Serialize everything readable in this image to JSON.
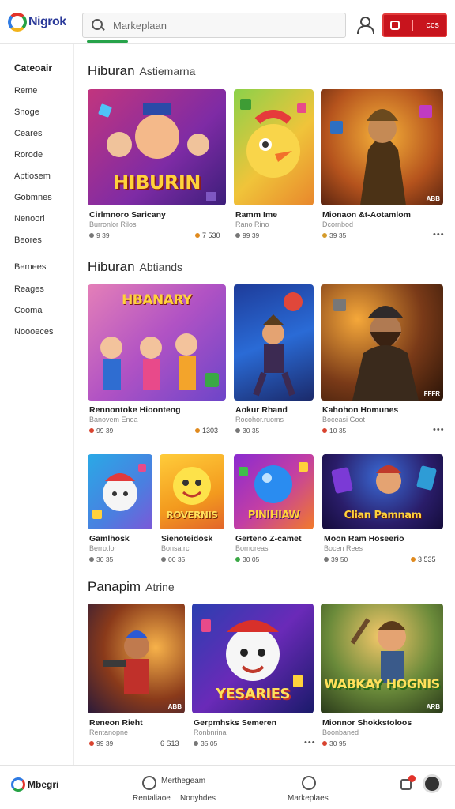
{
  "header": {
    "logo_text": "Nigrok",
    "search_placeholder": "Markeplaan",
    "cta_label": "ccs"
  },
  "sidebar": {
    "title": "Cateoair",
    "items": [
      "Reme",
      "Snoge",
      "Ceares",
      "Rorode",
      "Aptiosem",
      "Gobmnes",
      "Nenoorl",
      "Beores",
      "Bemees",
      "Reages",
      "Cooma",
      "Noooeces"
    ]
  },
  "sections": [
    {
      "title": "Hiburan",
      "subtitle": "Astiemarna"
    },
    {
      "title": "Hiburan",
      "subtitle": "Abtiands"
    },
    {
      "title": "Panapim",
      "subtitle": "Atrine"
    }
  ],
  "cards": [
    {
      "title": "Cirlmnoro Saricany",
      "sub": "Burronlor Rilos",
      "meta": "9 39",
      "price": "7 530",
      "thumb_text": "HIBURIN"
    },
    {
      "title": "Ramm Ime",
      "sub": "Rano Rino",
      "meta": "99 39",
      "price": "",
      "thumb_text": ""
    },
    {
      "title": "Mionaon &t-Aotamlom",
      "sub": "Dcornbod",
      "meta": "39 35",
      "price": "",
      "thumb_text": "",
      "badge": "ABB"
    },
    {
      "title": "Rennontoke Hioonteng",
      "sub": "Banovem Enoa",
      "meta": "99 39",
      "price": "1303",
      "thumb_text": "HBANARY"
    },
    {
      "title": "Aokur Rhand",
      "sub": "Rocohor.ruoms",
      "meta": "30 35",
      "price": "",
      "thumb_text": ""
    },
    {
      "title": "Kahohon Homunes",
      "sub": "Boceasi Goot",
      "meta": "10 35",
      "price": "",
      "thumb_text": "",
      "badge": "FFFR"
    },
    {
      "title": "Gamlhosk",
      "sub": "Berro.lor",
      "meta": "30 35",
      "price": "",
      "thumb_text": ""
    },
    {
      "title": "Sienoteidosk",
      "sub": "Bonsa.rcl",
      "meta": "00 35",
      "price": "",
      "thumb_text": "ROVERNIS"
    },
    {
      "title": "Gerteno Z-camet",
      "sub": "Bornoreas",
      "meta": "30 05",
      "price": "",
      "thumb_text": "PINIHIAW"
    },
    {
      "title": "Moon Ram Hoseerio",
      "sub": "Bocen Rees",
      "meta": "39 50",
      "price": "3 535",
      "thumb_text": "Clian Pamnam"
    },
    {
      "title": "Reneon Rieht",
      "sub": "Rentanopne",
      "meta": "99 39",
      "price": "6 S13",
      "thumb_text": "",
      "badge": "ABB"
    },
    {
      "title": "Gerpmhsks Semeren",
      "sub": "Ronbnrinal",
      "meta": "35 05",
      "price": "",
      "thumb_text": "YESARIES"
    },
    {
      "title": "Mionnor Shokkstoloos",
      "sub": "Boonbaned",
      "meta": "30 95",
      "price": "",
      "thumb_text": "WABKAY HOGNIS",
      "badge": "ARB"
    }
  ],
  "bottombar": {
    "logo_text": "Mbegri",
    "tab1_top": "Merthegeam",
    "tab1_bottom": "Rentaliaoe",
    "tab1_extra": "Nonyhdes",
    "tab2_label": "Markeplaes"
  },
  "colors": {
    "accent_red": "#c8141d",
    "accent_green": "#27a34a"
  }
}
